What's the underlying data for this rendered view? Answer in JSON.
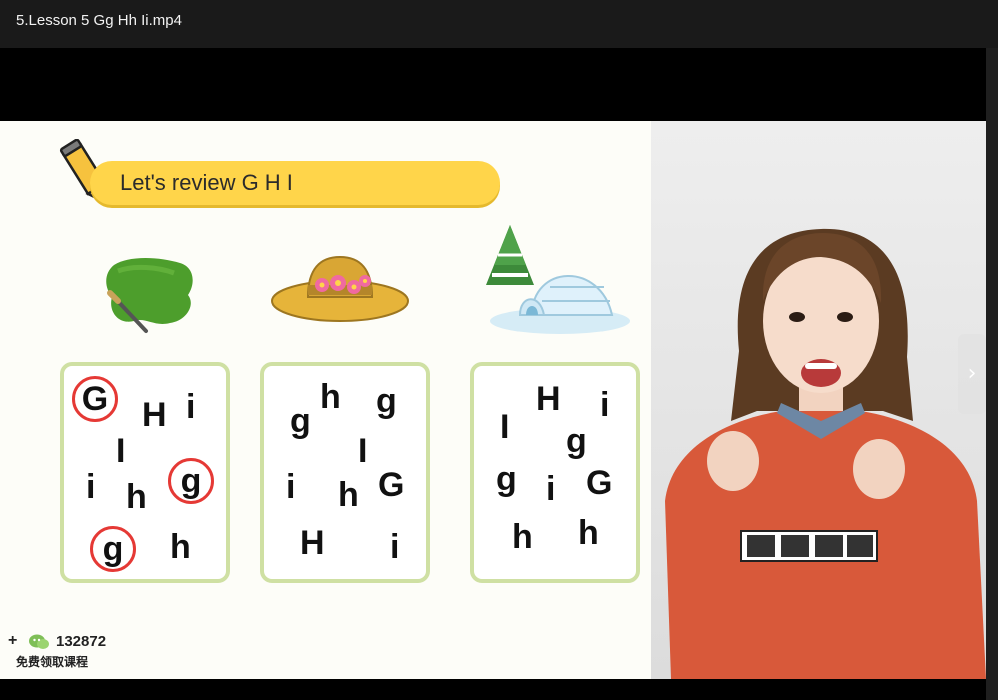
{
  "window": {
    "title": "5.Lesson 5 Gg Hh Ii.mp4"
  },
  "slide": {
    "banner_text": "Let's review G H I",
    "pictures": [
      "paint-blob",
      "straw-hat",
      "igloo"
    ],
    "boxes": [
      {
        "letters": [
          {
            "ch": "G",
            "circled": true
          },
          {
            "ch": "H",
            "circled": false
          },
          {
            "ch": "i",
            "circled": false
          },
          {
            "ch": "I",
            "circled": false
          },
          {
            "ch": "i",
            "circled": false
          },
          {
            "ch": "h",
            "circled": false
          },
          {
            "ch": "g",
            "circled": true
          },
          {
            "ch": "g",
            "circled": true
          },
          {
            "ch": "h",
            "circled": false
          }
        ]
      },
      {
        "letters": [
          {
            "ch": "g",
            "circled": false
          },
          {
            "ch": "h",
            "circled": false
          },
          {
            "ch": "g",
            "circled": false
          },
          {
            "ch": "I",
            "circled": false
          },
          {
            "ch": "i",
            "circled": false
          },
          {
            "ch": "h",
            "circled": false
          },
          {
            "ch": "G",
            "circled": false
          },
          {
            "ch": "H",
            "circled": false
          },
          {
            "ch": "i",
            "circled": false
          }
        ]
      },
      {
        "letters": [
          {
            "ch": "I",
            "circled": false
          },
          {
            "ch": "H",
            "circled": false
          },
          {
            "ch": "i",
            "circled": false
          },
          {
            "ch": "g",
            "circled": false
          },
          {
            "ch": "g",
            "circled": false
          },
          {
            "ch": "i",
            "circled": false
          },
          {
            "ch": "G",
            "circled": false
          },
          {
            "ch": "h",
            "circled": false
          },
          {
            "ch": "h",
            "circled": false
          }
        ]
      }
    ]
  },
  "promo": {
    "plus": "+",
    "id": "132872",
    "cn_text": "免费领取课程"
  },
  "controls": {
    "next_label": "›"
  },
  "colors": {
    "banner": "#ffd54a",
    "box_border": "#cfe0a3",
    "circle": "#e53935",
    "sweater": "#d8593a"
  }
}
